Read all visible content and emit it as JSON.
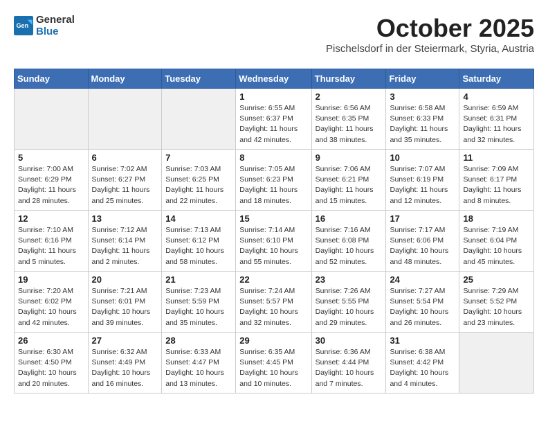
{
  "header": {
    "logo_general": "General",
    "logo_blue": "Blue",
    "month_year": "October 2025",
    "location": "Pischelsdorf in der Steiermark, Styria, Austria"
  },
  "weekdays": [
    "Sunday",
    "Monday",
    "Tuesday",
    "Wednesday",
    "Thursday",
    "Friday",
    "Saturday"
  ],
  "weeks": [
    [
      {
        "day": "",
        "info": ""
      },
      {
        "day": "",
        "info": ""
      },
      {
        "day": "",
        "info": ""
      },
      {
        "day": "1",
        "info": "Sunrise: 6:55 AM\nSunset: 6:37 PM\nDaylight: 11 hours\nand 42 minutes."
      },
      {
        "day": "2",
        "info": "Sunrise: 6:56 AM\nSunset: 6:35 PM\nDaylight: 11 hours\nand 38 minutes."
      },
      {
        "day": "3",
        "info": "Sunrise: 6:58 AM\nSunset: 6:33 PM\nDaylight: 11 hours\nand 35 minutes."
      },
      {
        "day": "4",
        "info": "Sunrise: 6:59 AM\nSunset: 6:31 PM\nDaylight: 11 hours\nand 32 minutes."
      }
    ],
    [
      {
        "day": "5",
        "info": "Sunrise: 7:00 AM\nSunset: 6:29 PM\nDaylight: 11 hours\nand 28 minutes."
      },
      {
        "day": "6",
        "info": "Sunrise: 7:02 AM\nSunset: 6:27 PM\nDaylight: 11 hours\nand 25 minutes."
      },
      {
        "day": "7",
        "info": "Sunrise: 7:03 AM\nSunset: 6:25 PM\nDaylight: 11 hours\nand 22 minutes."
      },
      {
        "day": "8",
        "info": "Sunrise: 7:05 AM\nSunset: 6:23 PM\nDaylight: 11 hours\nand 18 minutes."
      },
      {
        "day": "9",
        "info": "Sunrise: 7:06 AM\nSunset: 6:21 PM\nDaylight: 11 hours\nand 15 minutes."
      },
      {
        "day": "10",
        "info": "Sunrise: 7:07 AM\nSunset: 6:19 PM\nDaylight: 11 hours\nand 12 minutes."
      },
      {
        "day": "11",
        "info": "Sunrise: 7:09 AM\nSunset: 6:17 PM\nDaylight: 11 hours\nand 8 minutes."
      }
    ],
    [
      {
        "day": "12",
        "info": "Sunrise: 7:10 AM\nSunset: 6:16 PM\nDaylight: 11 hours\nand 5 minutes."
      },
      {
        "day": "13",
        "info": "Sunrise: 7:12 AM\nSunset: 6:14 PM\nDaylight: 11 hours\nand 2 minutes."
      },
      {
        "day": "14",
        "info": "Sunrise: 7:13 AM\nSunset: 6:12 PM\nDaylight: 10 hours\nand 58 minutes."
      },
      {
        "day": "15",
        "info": "Sunrise: 7:14 AM\nSunset: 6:10 PM\nDaylight: 10 hours\nand 55 minutes."
      },
      {
        "day": "16",
        "info": "Sunrise: 7:16 AM\nSunset: 6:08 PM\nDaylight: 10 hours\nand 52 minutes."
      },
      {
        "day": "17",
        "info": "Sunrise: 7:17 AM\nSunset: 6:06 PM\nDaylight: 10 hours\nand 48 minutes."
      },
      {
        "day": "18",
        "info": "Sunrise: 7:19 AM\nSunset: 6:04 PM\nDaylight: 10 hours\nand 45 minutes."
      }
    ],
    [
      {
        "day": "19",
        "info": "Sunrise: 7:20 AM\nSunset: 6:02 PM\nDaylight: 10 hours\nand 42 minutes."
      },
      {
        "day": "20",
        "info": "Sunrise: 7:21 AM\nSunset: 6:01 PM\nDaylight: 10 hours\nand 39 minutes."
      },
      {
        "day": "21",
        "info": "Sunrise: 7:23 AM\nSunset: 5:59 PM\nDaylight: 10 hours\nand 35 minutes."
      },
      {
        "day": "22",
        "info": "Sunrise: 7:24 AM\nSunset: 5:57 PM\nDaylight: 10 hours\nand 32 minutes."
      },
      {
        "day": "23",
        "info": "Sunrise: 7:26 AM\nSunset: 5:55 PM\nDaylight: 10 hours\nand 29 minutes."
      },
      {
        "day": "24",
        "info": "Sunrise: 7:27 AM\nSunset: 5:54 PM\nDaylight: 10 hours\nand 26 minutes."
      },
      {
        "day": "25",
        "info": "Sunrise: 7:29 AM\nSunset: 5:52 PM\nDaylight: 10 hours\nand 23 minutes."
      }
    ],
    [
      {
        "day": "26",
        "info": "Sunrise: 6:30 AM\nSunset: 4:50 PM\nDaylight: 10 hours\nand 20 minutes."
      },
      {
        "day": "27",
        "info": "Sunrise: 6:32 AM\nSunset: 4:49 PM\nDaylight: 10 hours\nand 16 minutes."
      },
      {
        "day": "28",
        "info": "Sunrise: 6:33 AM\nSunset: 4:47 PM\nDaylight: 10 hours\nand 13 minutes."
      },
      {
        "day": "29",
        "info": "Sunrise: 6:35 AM\nSunset: 4:45 PM\nDaylight: 10 hours\nand 10 minutes."
      },
      {
        "day": "30",
        "info": "Sunrise: 6:36 AM\nSunset: 4:44 PM\nDaylight: 10 hours\nand 7 minutes."
      },
      {
        "day": "31",
        "info": "Sunrise: 6:38 AM\nSunset: 4:42 PM\nDaylight: 10 hours\nand 4 minutes."
      },
      {
        "day": "",
        "info": ""
      }
    ]
  ]
}
